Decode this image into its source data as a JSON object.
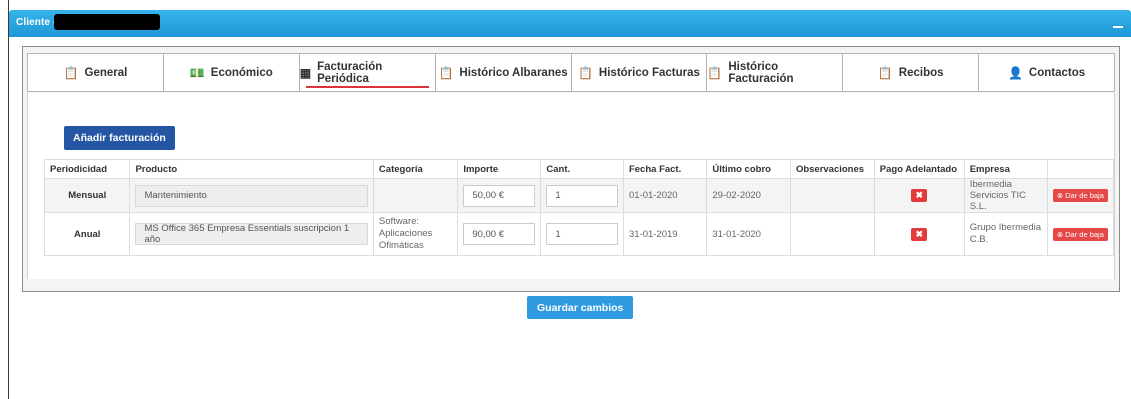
{
  "panel": {
    "title": "Cliente -",
    "accent": "#27a4df"
  },
  "tabs": [
    {
      "label": "General",
      "icon": "clipboard-icon",
      "active": false
    },
    {
      "label": "Económico",
      "icon": "money-icon",
      "active": false
    },
    {
      "label": "Facturación Periódica",
      "icon": "boxes-icon",
      "active": true
    },
    {
      "label": "Histórico Albaranes",
      "icon": "clipboard-icon",
      "active": false
    },
    {
      "label": "Histórico Facturas",
      "icon": "clipboard-icon",
      "active": false
    },
    {
      "label": "Histórico Facturación",
      "icon": "clipboard-list-icon",
      "active": false
    },
    {
      "label": "Recibos",
      "icon": "clipboard-icon",
      "active": false
    },
    {
      "label": "Contactos",
      "icon": "contact-card-icon",
      "active": false
    }
  ],
  "add_button": "Añadir facturación",
  "table": {
    "headers": [
      "Periodicidad",
      "Producto",
      "Categoría",
      "Importe",
      "Cant.",
      "Fecha Fact.",
      "Último cobro",
      "Observaciones",
      "Pago Adelantado",
      "Empresa",
      ""
    ],
    "rows": [
      {
        "periodicidad": "Mensual",
        "producto": "Mantenimiento",
        "categoria": "",
        "importe": "50,00 €",
        "cant": "1",
        "fecha_fact": "01-01-2020",
        "ultimo_cobro": "29-02-2020",
        "observaciones": "",
        "empresa": "Ibermedia Servicios TIC S.L.",
        "baja_label": "Dar de baja"
      },
      {
        "periodicidad": "Anual",
        "producto": "MS Office 365 Empresa Essentials suscripcion 1 año",
        "categoria": "Software: Aplicaciones Ofimáticas",
        "importe": "90,00 €",
        "cant": "1",
        "fecha_fact": "31-01-2019",
        "ultimo_cobro": "31-01-2020",
        "observaciones": "",
        "empresa": "Grupo Ibermedia C.B.",
        "baja_label": "Dar de baja"
      }
    ]
  },
  "save_button": "Guardar cambios"
}
